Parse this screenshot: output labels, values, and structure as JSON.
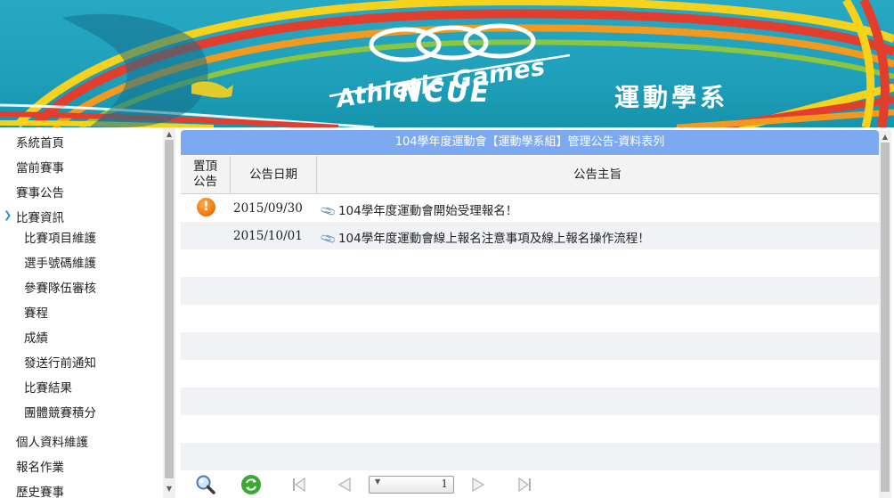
{
  "banner": {
    "title": "Athletic Games",
    "subtitle": "NCUE",
    "dept": "運動學系",
    "logo_icon": "rings-logo-icon"
  },
  "sidebar": {
    "items": [
      {
        "label": "系統首頁",
        "level": 0
      },
      {
        "label": "當前賽事",
        "level": 0
      },
      {
        "label": "賽事公告",
        "level": 0
      },
      {
        "label": "比賽資訊",
        "level": 0,
        "expanded": true,
        "icon": "chevron-down-icon"
      },
      {
        "label": "比賽項目維護",
        "level": 1
      },
      {
        "label": "選手號碼維護",
        "level": 1
      },
      {
        "label": "參賽隊伍審核",
        "level": 1
      },
      {
        "label": "賽程",
        "level": 1
      },
      {
        "label": "成績",
        "level": 1
      },
      {
        "label": "發送行前通知",
        "level": 1
      },
      {
        "label": "比賽結果",
        "level": 1
      },
      {
        "label": "團體競賽積分",
        "level": 1
      },
      {
        "label": "個人資料維護",
        "level": 0
      },
      {
        "label": "報名作業",
        "level": 0
      },
      {
        "label": "歷史賽事",
        "level": 0
      }
    ]
  },
  "panel": {
    "title": "104學年度運動會【運動學系組】管理公告-資料表列",
    "columns": {
      "pin": "置頂\n公告",
      "date": "公告日期",
      "subject": "公告主旨"
    },
    "rows": [
      {
        "pinned": true,
        "pin_icon": "exclamation-icon",
        "date": "2015/09/30",
        "subject": "104學年度運動會開始受理報名！",
        "attach_icon": "paperclip-icon"
      },
      {
        "pinned": false,
        "date": "2015/10/01",
        "subject": "104學年度運動會線上報名注意事項及線上報名操作流程！",
        "attach_icon": "paperclip-icon"
      }
    ]
  },
  "pager": {
    "page": "1",
    "icons": [
      "search-icon",
      "refresh-icon",
      "first-page-icon",
      "prev-page-icon",
      "next-page-icon",
      "last-page-icon"
    ]
  },
  "colors": {
    "banner": "#1fa0bb",
    "header_bar": "#7ca9f0",
    "alt_row": "#f0f2f6",
    "pin": "#f27a14"
  }
}
